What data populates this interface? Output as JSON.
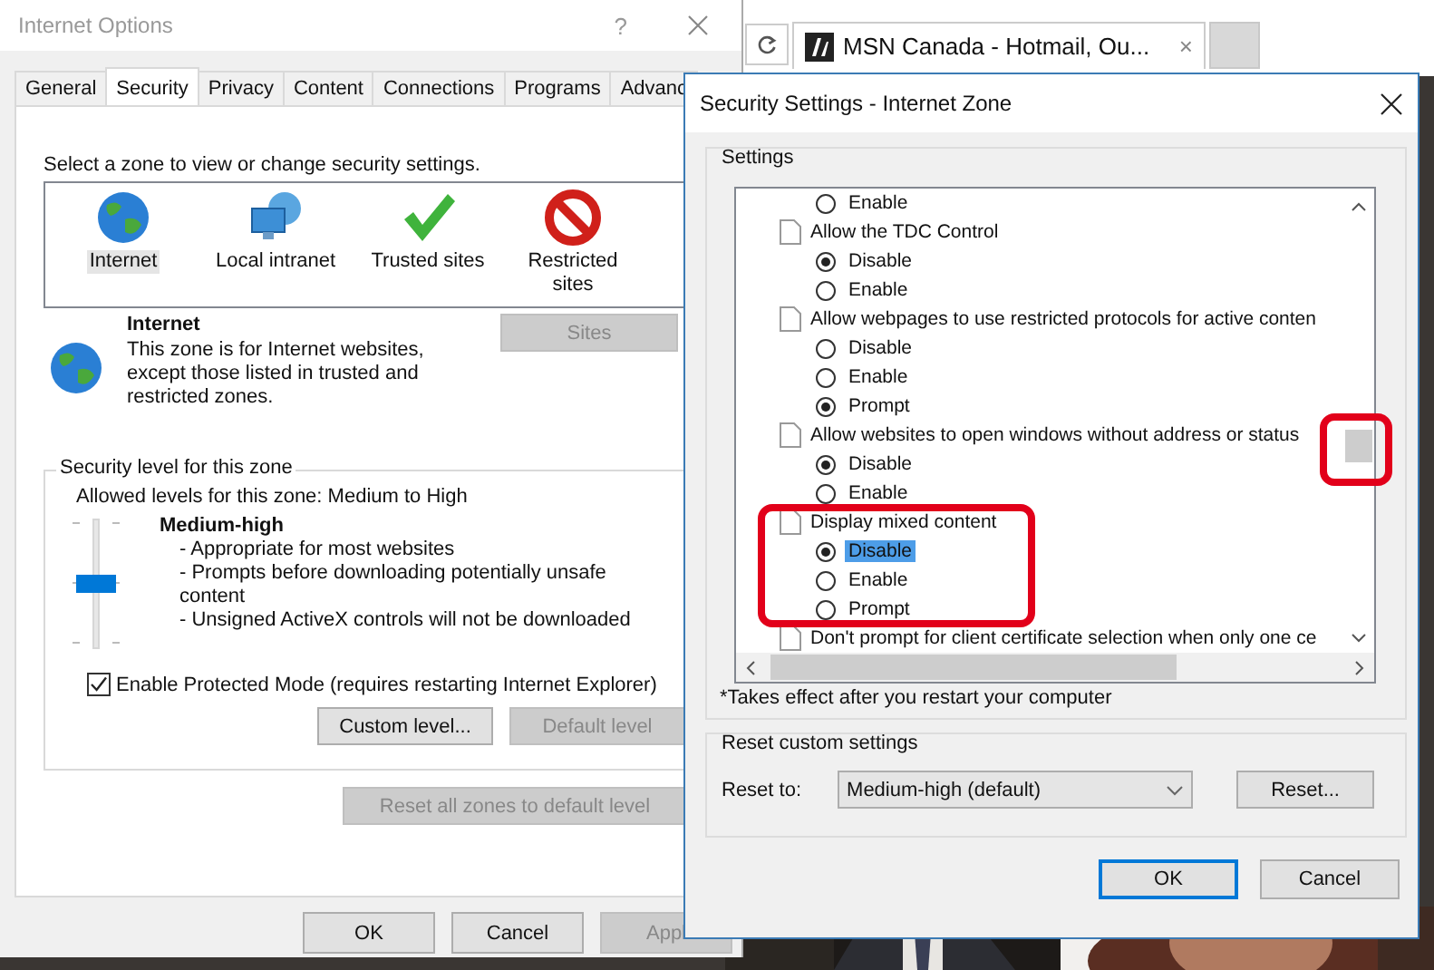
{
  "browser": {
    "tab_title": "MSN Canada - Hotmail, Ou...",
    "tab_close": "×"
  },
  "internet_options": {
    "title": "Internet Options",
    "help": "?",
    "tabs": [
      {
        "label": "General",
        "selected": false
      },
      {
        "label": "Security",
        "selected": true
      },
      {
        "label": "Privacy",
        "selected": false
      },
      {
        "label": "Content",
        "selected": false
      },
      {
        "label": "Connections",
        "selected": false
      },
      {
        "label": "Programs",
        "selected": false
      },
      {
        "label": "Advanc",
        "selected": false
      }
    ],
    "zone_prompt": "Select a zone to view or change security settings.",
    "zones": [
      {
        "kind": "internet",
        "label": "Internet",
        "selected": true
      },
      {
        "kind": "intranet",
        "label": "Local intranet",
        "selected": false
      },
      {
        "kind": "trusted",
        "label": "Trusted sites",
        "selected": false
      },
      {
        "kind": "restricted",
        "label": "Restricted sites",
        "selected": false
      }
    ],
    "zone_info": {
      "name": "Internet",
      "description": "This zone is for Internet websites, except those listed in trusted and restricted zones."
    },
    "sites_button": {
      "label": "Sites",
      "disabled": true
    },
    "security_level": {
      "legend": "Security level for this zone",
      "allowed": "Allowed levels for this zone: Medium to High",
      "level": 0.5,
      "level_name": "Medium-high",
      "details": [
        "- Appropriate for most websites",
        "- Prompts before downloading potentially unsafe content",
        "- Unsigned ActiveX controls will not be downloaded"
      ]
    },
    "protected_mode": {
      "label": "Enable Protected Mode (requires restarting Internet Explorer)",
      "checked": true
    },
    "level_buttons": [
      {
        "label": "Custom level...",
        "disabled": false
      },
      {
        "label": "Default level",
        "disabled": true
      }
    ],
    "reset_all": {
      "label": "Reset all zones to default level",
      "disabled": true
    },
    "footer_buttons": [
      {
        "label": "OK",
        "disabled": false
      },
      {
        "label": "Cancel",
        "disabled": false
      },
      {
        "label": "Appl",
        "disabled": true
      }
    ]
  },
  "security_settings": {
    "title": "Security Settings - Internet Zone",
    "settings_legend": "Settings",
    "items": [
      {
        "kind": "option",
        "label": "Enable",
        "selected": false,
        "highlighted": false
      },
      {
        "kind": "setting",
        "label": "Allow the TDC Control"
      },
      {
        "kind": "option",
        "label": "Disable",
        "selected": true,
        "highlighted": false
      },
      {
        "kind": "option",
        "label": "Enable",
        "selected": false,
        "highlighted": false
      },
      {
        "kind": "setting",
        "label": "Allow webpages to use restricted protocols for active conten"
      },
      {
        "kind": "option",
        "label": "Disable",
        "selected": false,
        "highlighted": false
      },
      {
        "kind": "option",
        "label": "Enable",
        "selected": false,
        "highlighted": false
      },
      {
        "kind": "option",
        "label": "Prompt",
        "selected": true,
        "highlighted": false
      },
      {
        "kind": "setting",
        "label": "Allow websites to open windows without address or status"
      },
      {
        "kind": "option",
        "label": "Disable",
        "selected": true,
        "highlighted": false
      },
      {
        "kind": "option",
        "label": "Enable",
        "selected": false,
        "highlighted": false
      },
      {
        "kind": "setting",
        "label": "Display mixed content"
      },
      {
        "kind": "option",
        "label": "Disable",
        "selected": true,
        "highlighted": true
      },
      {
        "kind": "option",
        "label": "Enable",
        "selected": false,
        "highlighted": false
      },
      {
        "kind": "option",
        "label": "Prompt",
        "selected": false,
        "highlighted": false
      },
      {
        "kind": "setting",
        "label": "Don't prompt for client certificate selection when only one ce"
      }
    ],
    "note": "*Takes effect after you restart your computer",
    "reset": {
      "legend": "Reset custom settings",
      "label": "Reset to:",
      "value": "Medium-high (default)",
      "button": "Reset..."
    },
    "buttons": [
      {
        "label": "OK",
        "default": true
      },
      {
        "label": "Cancel",
        "default": false
      }
    ]
  }
}
